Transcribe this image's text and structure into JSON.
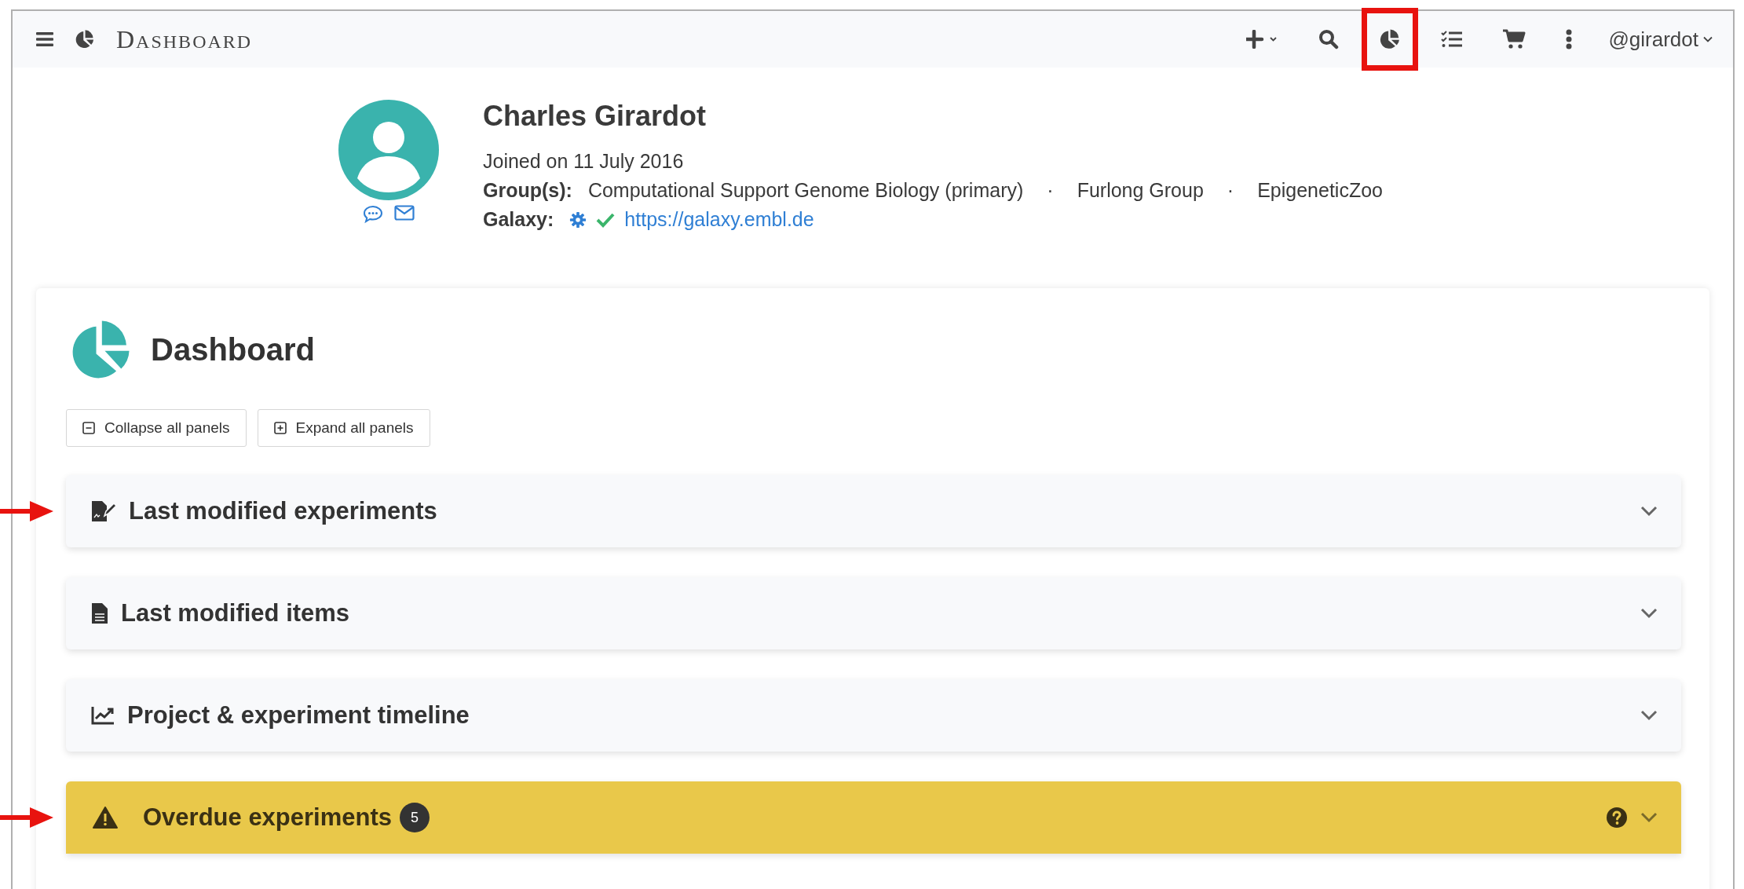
{
  "navbar": {
    "brand": "DASHBOARD",
    "tools": [
      {
        "kind": "add",
        "highlighted": false
      },
      {
        "kind": "search",
        "highlighted": false
      },
      {
        "kind": "dashboard",
        "highlighted": true
      },
      {
        "kind": "tasks",
        "highlighted": false
      },
      {
        "kind": "cart",
        "highlighted": false
      },
      {
        "kind": "more",
        "highlighted": false
      }
    ],
    "user": "@girardot"
  },
  "profile": {
    "name": "Charles Girardot",
    "joined": "Joined on 11 July 2016",
    "groups_label": "Group(s):",
    "groups": [
      "Computational Support Genome Biology (primary)",
      "Furlong Group",
      "EpigeneticZoo"
    ],
    "separator": "·",
    "galaxy_label": "Galaxy:",
    "galaxy_link": "https://galaxy.embl.de"
  },
  "dashboard": {
    "title": "Dashboard",
    "buttons": [
      {
        "kind": "collapse",
        "label": "Collapse all panels"
      },
      {
        "kind": "expand",
        "label": "Expand all panels"
      }
    ],
    "panels": [
      {
        "kind": "default",
        "title": "Last modified experiments",
        "marked": true
      },
      {
        "kind": "default",
        "title": "Last modified items",
        "marked": false
      },
      {
        "kind": "default",
        "title": "Project & experiment timeline",
        "marked": false
      },
      {
        "kind": "warning",
        "title": "Overdue experiments",
        "badge": "5",
        "marked": true
      }
    ]
  }
}
